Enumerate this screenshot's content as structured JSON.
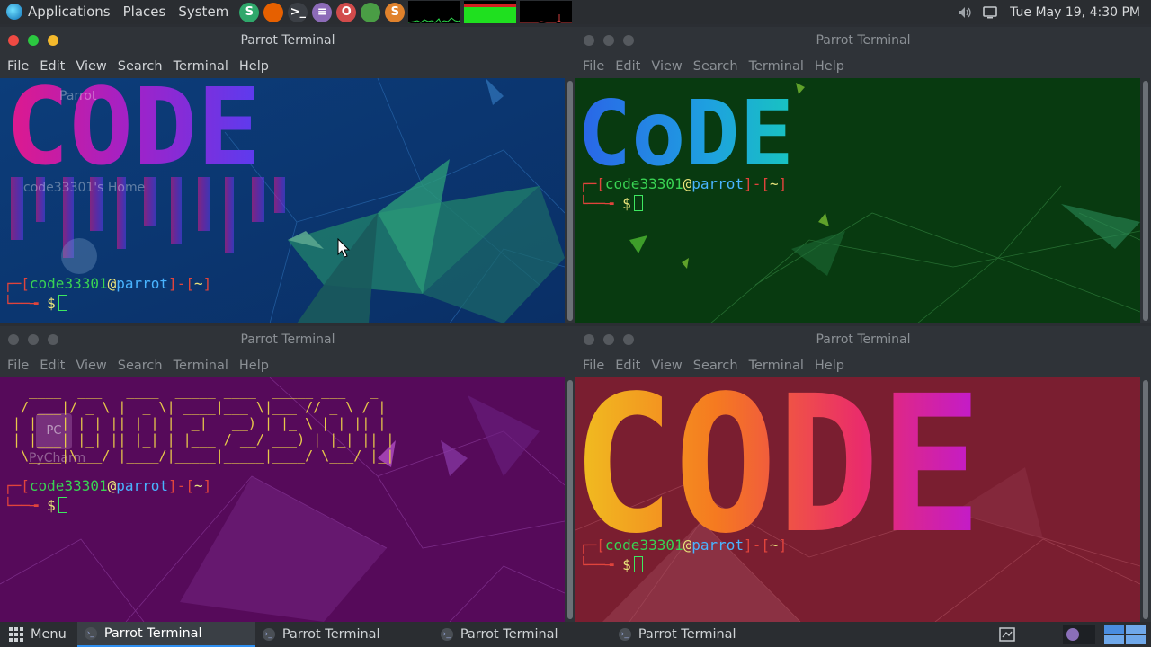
{
  "top_panel": {
    "menus": [
      "Applications",
      "Places",
      "System"
    ],
    "launchers": [
      {
        "icon": "s-app-icon",
        "glyph": "S",
        "color": "#2fa86b"
      },
      {
        "icon": "firefox-icon",
        "glyph": "",
        "color": "#e66000"
      },
      {
        "icon": "terminal-icon",
        "glyph": ">_",
        "color": "#3b3f45"
      },
      {
        "icon": "text-editor-icon",
        "glyph": "≡",
        "color": "#8c6bb8"
      },
      {
        "icon": "opera-icon",
        "glyph": "O",
        "color": "#d24b4b"
      },
      {
        "icon": "chrome-icon",
        "glyph": "",
        "color": "#4a9d45"
      },
      {
        "icon": "sublime-icon",
        "glyph": "S",
        "color": "#e0822c"
      }
    ],
    "clock": "Tue May 19,  4:30 PM",
    "tray": [
      "volume-icon",
      "display-icon"
    ]
  },
  "windows": [
    {
      "title": "Parrot Terminal",
      "menu": [
        "File",
        "Edit",
        "View",
        "Search",
        "Terminal",
        "Help"
      ]
    },
    {
      "title": "Parrot Terminal",
      "menu": [
        "File",
        "Edit",
        "View",
        "Search",
        "Terminal",
        "Help"
      ]
    },
    {
      "title": "Parrot Terminal",
      "menu": [
        "File",
        "Edit",
        "View",
        "Search",
        "Terminal",
        "Help"
      ]
    },
    {
      "title": "Parrot Terminal",
      "menu": [
        "File",
        "Edit",
        "View",
        "Search",
        "Terminal",
        "Help"
      ]
    }
  ],
  "prompt": {
    "user": "code33301",
    "at": "@",
    "host": "parrot",
    "open_bracket": "[",
    "close_bracket": "]",
    "dash": "-",
    "dir": "~",
    "dollar": "$"
  },
  "banners": {
    "w1": "CODE",
    "w2": "CoDE",
    "w4": "CODE",
    "w3_ascii": "  ____  ___   ____  _____ ____  _____ ___   _\n / ___|/ _ \\ |  _ \\| ____|___ \\|___ // _ \\ / |\n| |   | | | || | | |  _|   __) | |_ \\ | | || |\n| |___| |_| || |_| | |___ / __/ ___) | |_| || |\n \\____|\\___/ |____/|_____|_____|____/ \\___/ |_|"
  },
  "desktop_icons": {
    "home_label": "code33301's Home",
    "parrot_label": "Parrot",
    "pycharm_label": "PyCharm",
    "pycharm_badge": "PC"
  },
  "bottom_panel": {
    "menu_label": "Menu",
    "tasks": [
      "Parrot Terminal",
      "Parrot Terminal",
      "Parrot Terminal",
      "Parrot Terminal"
    ],
    "active_task": 0
  },
  "colors": {
    "w1_bg": "#0b3f7a",
    "w2_bg": "#083b12",
    "w3_bg": "#5a0b5c",
    "w4_bg": "#7a1f33"
  }
}
